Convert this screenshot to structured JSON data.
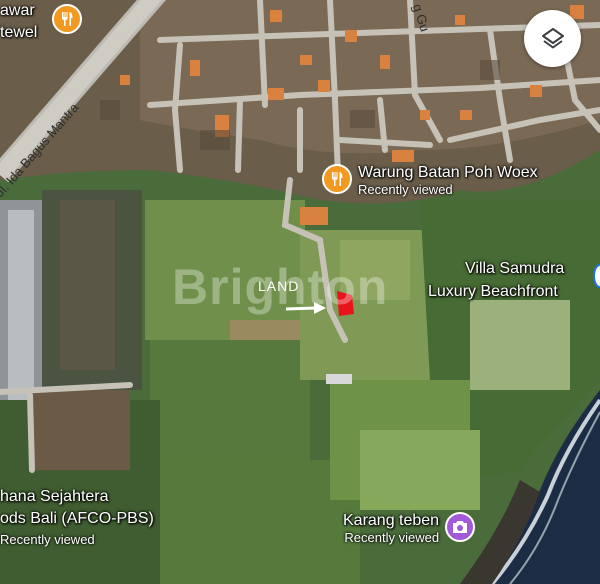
{
  "map": {
    "roads": {
      "main_road": "Jl. Ida Bagus Mantra",
      "top_left_partial": "awar",
      "top_left_partial_2": "tewel",
      "top_partial": "g Gu"
    },
    "pois": [
      {
        "name": "Warung Batan Poh Woex",
        "status": "Recently viewed",
        "icon": "restaurant-icon",
        "color": "#f29a1f"
      },
      {
        "name": "Karang teben",
        "status": "Recently viewed",
        "icon": "photo-icon",
        "color": "#a35ad8"
      }
    ],
    "places": {
      "villa_line1": "Villa Samudra",
      "villa_line2": "Luxury Beachfront",
      "afco_line1": "hana Sejahtera",
      "afco_line2": "ods Bali (AFCO-PBS)",
      "afco_status": "Recently viewed"
    },
    "annotation": {
      "land_label": "LAND",
      "marker_color": "#e8141b"
    },
    "watermark": "Brighton",
    "controls": {
      "layers": "layers-icon"
    }
  }
}
